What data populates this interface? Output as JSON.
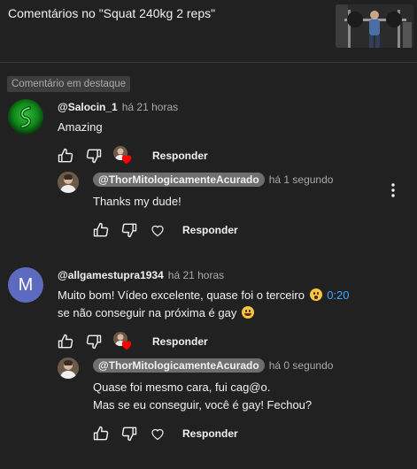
{
  "header": {
    "title": "Comentários no \"Squat 240kg 2 reps\""
  },
  "pinned_label": "Comentário em destaque",
  "comments": [
    {
      "author": "@Salocin_1",
      "time": "há 21 horas",
      "text": "Amazing",
      "reply_label": "Responder",
      "reply": {
        "author": "@ThorMitologicamenteAcurado",
        "time": "há 1 segundo",
        "lines": [
          "Thanks my dude!"
        ],
        "reply_label": "Responder"
      }
    },
    {
      "author": "@allgamestupra1934",
      "avatar_letter": "M",
      "time": "há 21 horas",
      "line1": "Muito bom! Vídeo excelente, quase foi o terceiro",
      "timestamp_link": "0:20",
      "line2": "se não conseguir na próxima é gay",
      "reply_label": "Responder",
      "reply": {
        "author": "@ThorMitologicamenteAcurado",
        "time": "há 0 segundo",
        "lines": [
          "Quase foi mesmo cara, fui cag@o.",
          "Mas se eu conseguir, você é gay! Fechou?"
        ],
        "reply_label": "Responder"
      }
    }
  ],
  "colors": {
    "background": "#212121",
    "text": "#f1f1f1",
    "secondary_text": "#aaaaaa",
    "link": "#3ea6ff",
    "heart": "#ff0000",
    "author_chip": "#6e6e6e"
  },
  "icons": {
    "like": "thumb-up-icon",
    "dislike": "thumb-down-icon",
    "heart": "heart-icon",
    "more": "more-vertical-icon"
  }
}
